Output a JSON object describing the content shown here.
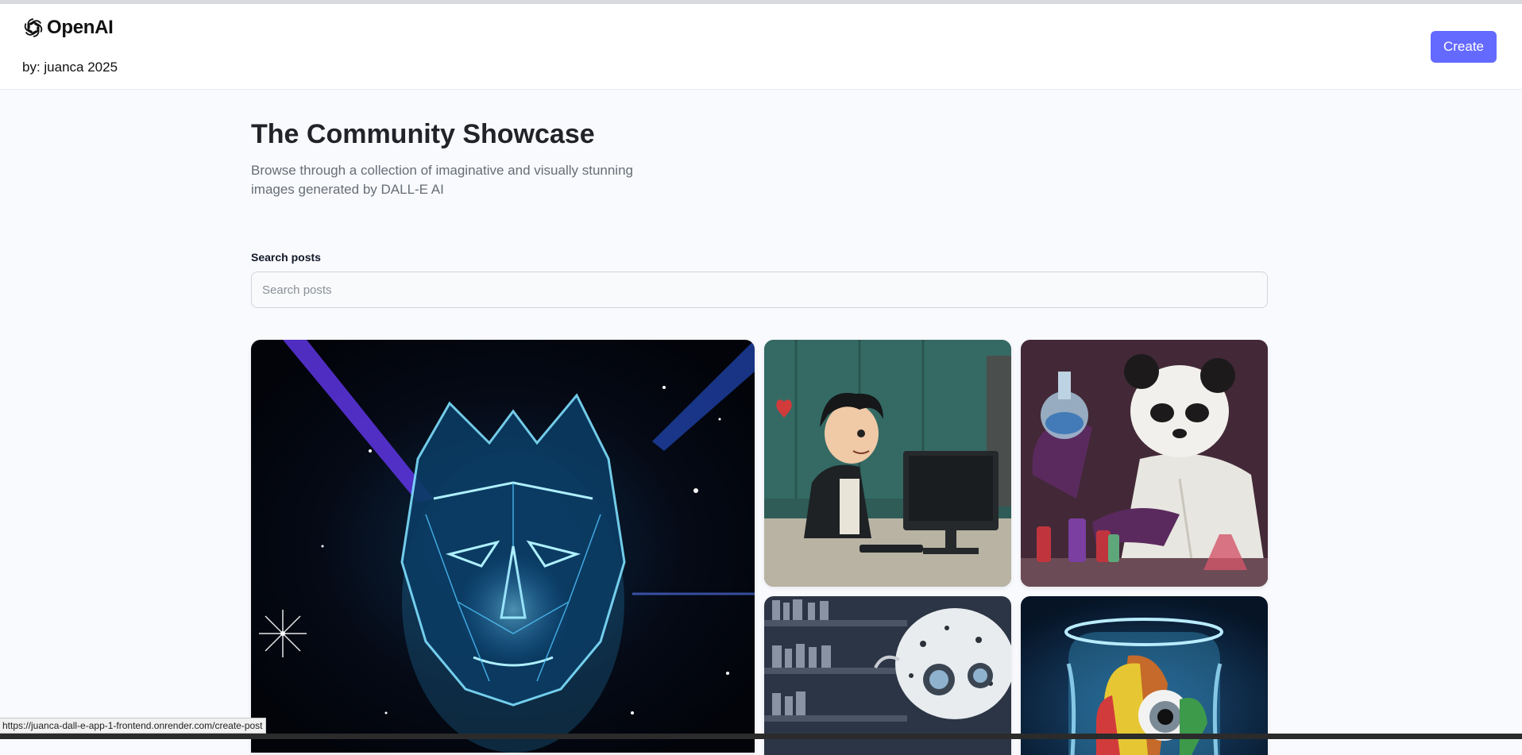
{
  "header": {
    "logo_text": "OpenAI",
    "byline": "by: juanca 2025",
    "create_label": "Create",
    "logo_icon": "openai-logo-icon"
  },
  "main": {
    "title": "The Community Showcase",
    "subtitle": "Browse through a collection of imaginative and visually stunning images generated by DALL-E AI",
    "search": {
      "label": "Search posts",
      "placeholder": "Search posts",
      "value": ""
    },
    "gallery": [
      {
        "subject": "glowing blue wireframe human head in space"
      },
      {
        "subject": "cartoon boy at computer with heart"
      },
      {
        "subject": "panda scientist with flask"
      },
      {
        "subject": "robot reading in library"
      },
      {
        "subject": "colorful fish in glass jar"
      }
    ]
  },
  "status_bar": {
    "url": "https://juanca-dall-e-app-1-frontend.onrender.com/create-post"
  },
  "colors": {
    "accent": "#6469ff",
    "page_background": "#f9fafe",
    "title": "#222328",
    "subtitle": "#666e75"
  }
}
